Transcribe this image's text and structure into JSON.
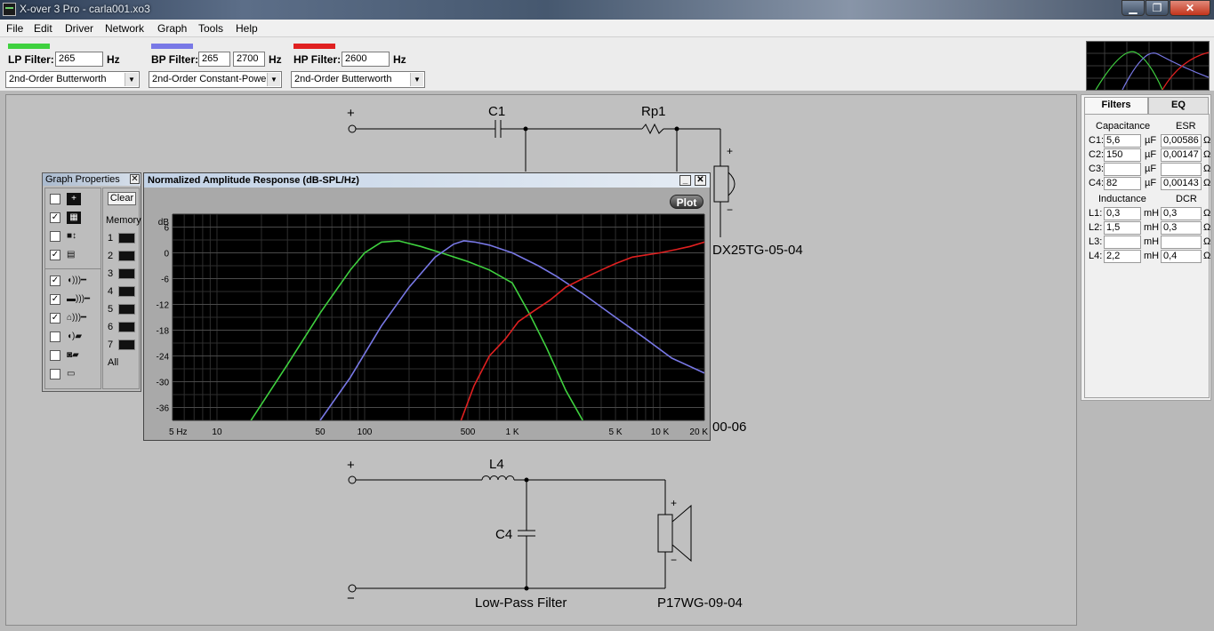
{
  "window": {
    "title": "X-over 3 Pro  -  carla001.xo3",
    "minimize": "▁",
    "maximize": "❐",
    "close": "✕"
  },
  "menu": [
    "File",
    "Edit",
    "Driver",
    "Network",
    "Graph",
    "Tools",
    "Help"
  ],
  "filters": {
    "lp": {
      "label": "LP Filter:",
      "value": "265",
      "unit": "Hz",
      "type": "2nd-Order Butterworth",
      "color": "#3fd13f"
    },
    "bp": {
      "label": "BP Filter:",
      "value_low": "265",
      "value_high": "2700",
      "unit": "Hz",
      "type": "2nd-Order Constant-Powe",
      "color": "#7878e6"
    },
    "hp": {
      "label": "HP Filter:",
      "value": "2600",
      "unit": "Hz",
      "type": "2nd-Order Butterworth",
      "color": "#e02020"
    }
  },
  "schematic": {
    "hp_section": {
      "c1": "C1",
      "rp1": "Rp1",
      "driver": "DX25TG-05-04",
      "plus": "+",
      "minus": "−"
    },
    "mid_driver_suffix": "00-06",
    "lp_section": {
      "l4": "L4",
      "c4": "C4",
      "title": "Low-Pass Filter",
      "driver": "P17WG-09-04",
      "plus": "+",
      "minus": "−"
    }
  },
  "panel": {
    "tabs": [
      "Filters",
      "EQ"
    ],
    "capacitance_header": "Capacitance",
    "esr_header": "ESR",
    "capacitors": [
      {
        "label": "C1:",
        "value": "5,6",
        "unit": "µF",
        "esr": "0,00586",
        "ohm": "Ω"
      },
      {
        "label": "C2:",
        "value": "150",
        "unit": "µF",
        "esr": "0,00147",
        "ohm": "Ω"
      },
      {
        "label": "C3:",
        "value": "",
        "unit": "µF",
        "esr": "",
        "ohm": "Ω"
      },
      {
        "label": "C4:",
        "value": "82",
        "unit": "µF",
        "esr": "0,00143",
        "ohm": "Ω"
      }
    ],
    "inductance_header": "Inductance",
    "dcr_header": "DCR",
    "inductors": [
      {
        "label": "L1:",
        "value": "0,3",
        "unit": "mH",
        "dcr": "0,3",
        "ohm": "Ω"
      },
      {
        "label": "L2:",
        "value": "1,5",
        "unit": "mH",
        "dcr": "0,3",
        "ohm": "Ω"
      },
      {
        "label": "L3:",
        "value": "",
        "unit": "mH",
        "dcr": "",
        "ohm": "Ω"
      },
      {
        "label": "L4:",
        "value": "2,2",
        "unit": "mH",
        "dcr": "0,4",
        "ohm": "Ω"
      }
    ]
  },
  "graph_properties": {
    "title": "Graph Properties",
    "close": "✕",
    "clear": "Clear",
    "memory": "Memory",
    "slots": [
      "1",
      "2",
      "3",
      "4",
      "5",
      "6",
      "7"
    ],
    "all": "All",
    "checks": [
      false,
      true,
      false,
      true,
      true,
      true,
      true,
      false,
      false,
      false
    ]
  },
  "graph": {
    "title": "Normalized Amplitude Response (dB-SPL/Hz)",
    "plot_button": "Plot",
    "minimize": "_",
    "close": "✕"
  },
  "chart_data": {
    "type": "line",
    "title": "Normalized Amplitude Response (dB-SPL/Hz)",
    "ylabel": "dB",
    "xscale": "log",
    "xlim": [
      5,
      20000
    ],
    "ylim": [
      -39,
      9
    ],
    "yticks": [
      6,
      0,
      -6,
      -12,
      -18,
      -24,
      -30,
      -36
    ],
    "xticks": [
      {
        "value": 5,
        "label": "5 Hz"
      },
      {
        "value": 10,
        "label": "10"
      },
      {
        "value": 50,
        "label": "50"
      },
      {
        "value": 100,
        "label": "100"
      },
      {
        "value": 500,
        "label": "500"
      },
      {
        "value": 1000,
        "label": "1 K"
      },
      {
        "value": 5000,
        "label": "5 K"
      },
      {
        "value": 10000,
        "label": "10 K"
      },
      {
        "value": 20000,
        "label": "20 K"
      }
    ],
    "grid": true,
    "series": [
      {
        "color": "#3fd13f",
        "x": [
          17,
          30,
          50,
          80,
          100,
          130,
          170,
          240,
          330,
          500,
          700,
          1000,
          1300,
          1700,
          2300,
          3000
        ],
        "y": [
          -39,
          -26,
          -14,
          -4,
          0,
          2.5,
          2.8,
          1.5,
          0,
          -2,
          -4,
          -7,
          -14,
          -22,
          -32,
          -39
        ]
      },
      {
        "color": "#7878e6",
        "x": [
          50,
          80,
          130,
          200,
          300,
          400,
          470,
          560,
          700,
          1000,
          1500,
          2000,
          3000,
          5000,
          8000,
          12000,
          20000
        ],
        "y": [
          -39,
          -29,
          -17,
          -8,
          -1,
          2,
          2.8,
          2.5,
          1.8,
          0,
          -3,
          -5.5,
          -9.5,
          -15,
          -20,
          -24.5,
          -28
        ]
      },
      {
        "color": "#e02020",
        "x": [
          450,
          550,
          700,
          900,
          1100,
          1400,
          1800,
          2300,
          3000,
          4000,
          5000,
          6500,
          8000,
          10000,
          13000,
          16000,
          20000
        ],
        "y": [
          -39,
          -31,
          -24,
          -20,
          -16,
          -13.5,
          -11,
          -8,
          -6,
          -4,
          -2.5,
          -1,
          -0.5,
          0,
          0.8,
          1.5,
          2.5
        ]
      }
    ]
  }
}
